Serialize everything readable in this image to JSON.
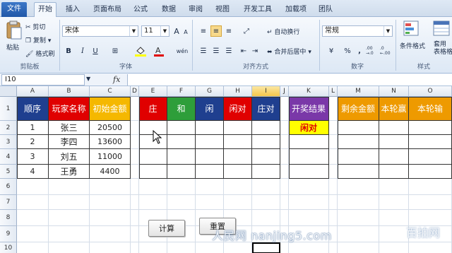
{
  "tabs": [
    "文件",
    "开始",
    "插入",
    "页面布局",
    "公式",
    "数据",
    "审阅",
    "视图",
    "开发工具",
    "加载项",
    "团队"
  ],
  "ribbon": {
    "clipboard": {
      "paste": "粘贴",
      "cut": "剪切",
      "copy": "复制",
      "copy_arrow": "▾",
      "format_painter": "格式刷",
      "label": "剪贴板"
    },
    "font": {
      "name": "宋体",
      "size": "11",
      "grow": "A",
      "shrink": "A",
      "bold": "B",
      "italic": "I",
      "underline": "U",
      "phonetic": "wén",
      "label": "字体",
      "font_color_letter": "A"
    },
    "alignment": {
      "wrap": "自动换行",
      "merge": "合并后居中",
      "label": "对齐方式"
    },
    "number": {
      "format": "常规",
      "currency": "¥",
      "percent": "%",
      "comma": ",",
      "inc_decimal": ".00 →.0",
      "dec_decimal": ".0 ←.00",
      "label": "数字"
    },
    "styles": {
      "conditional": "条件格式",
      "table": "套用\n表格格式",
      "label": "样式"
    }
  },
  "formula_bar": {
    "name_box": "I10",
    "fx": "fx",
    "content": ""
  },
  "columns": [
    "A",
    "B",
    "C",
    "D",
    "E",
    "F",
    "G",
    "H",
    "I",
    "J",
    "K",
    "L",
    "M",
    "N",
    "O"
  ],
  "rows": [
    "1",
    "2",
    "3",
    "4",
    "5",
    "6",
    "7",
    "8",
    "9",
    "10"
  ],
  "header_row": {
    "A": "顺序",
    "B": "玩家名称",
    "C": "初始金额",
    "E": "庄",
    "F": "和",
    "G": "闲",
    "H": "闲对",
    "I": "庄对",
    "K": "开奖结果",
    "M": "剩余金额",
    "N": "本轮赢",
    "O": "本轮输"
  },
  "players": [
    {
      "order": "1",
      "name": "张三",
      "amount": "20500"
    },
    {
      "order": "2",
      "name": "李四",
      "amount": "13600"
    },
    {
      "order": "3",
      "name": "刘五",
      "amount": "11000"
    },
    {
      "order": "4",
      "name": "王勇",
      "amount": "4400"
    }
  ],
  "result": "闲对",
  "buttons": {
    "calculate": "计算",
    "reset": "重置"
  },
  "watermark": "人民网 nanjing5.com",
  "watermark2": "百拍网",
  "colors": {
    "blue": "#1f3f8f",
    "red": "#e00000",
    "gold": "#f5b800",
    "green": "#2e9e3a",
    "purple": "#7a38a8",
    "orange": "#ee9a00",
    "yellow": "#ffff00",
    "selected_col": "#f5c64a"
  }
}
